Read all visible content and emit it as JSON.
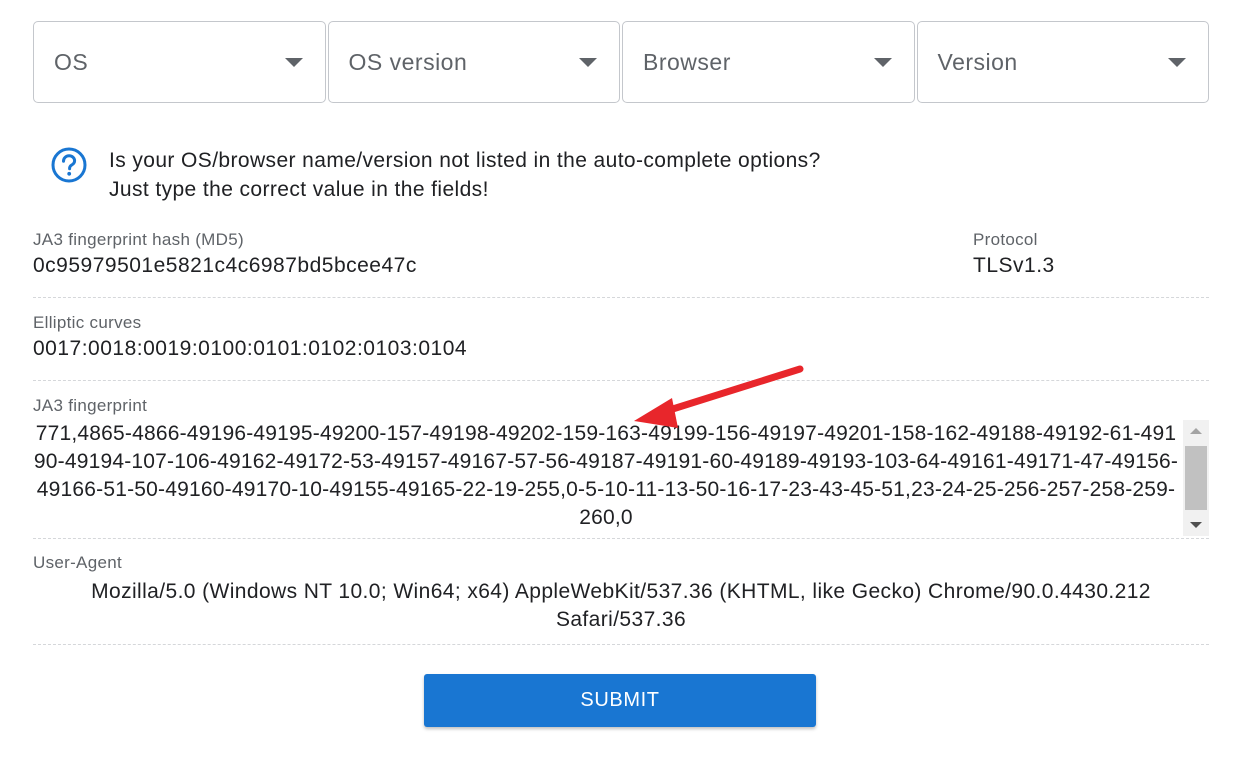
{
  "selects": [
    {
      "label": "OS"
    },
    {
      "label": "OS version"
    },
    {
      "label": "Browser"
    },
    {
      "label": "Version"
    }
  ],
  "hint": {
    "line1": "Is your OS/browser name/version not listed in the auto-complete options?",
    "line2": "Just type the correct value in the fields!",
    "icon": "help-circle-icon"
  },
  "ja3_hash": {
    "label": "JA3 fingerprint hash (MD5)",
    "value": "0c95979501e5821c4c6987bd5bcee47c"
  },
  "protocol": {
    "label": "Protocol",
    "value": "TLSv1.3"
  },
  "elliptic_curves": {
    "label": "Elliptic curves",
    "value": "0017:0018:0019:0100:0101:0102:0103:0104"
  },
  "ja3_fingerprint": {
    "label": "JA3 fingerprint",
    "value": "771,4865-4866-49196-49195-49200-157-49198-49202-159-163-49199-156-49197-49201-158-162-49188-49192-61-49190-49194-107-106-49162-49172-53-49157-49167-57-56-49187-49191-60-49189-49193-103-64-49161-49171-47-49156-49166-51-50-49160-49170-10-49155-49165-22-19-255,0-5-10-11-13-50-16-17-23-43-45-51,23-24-25-256-257-258-259-260,0"
  },
  "user_agent": {
    "label": "User-Agent",
    "value": "Mozilla/5.0 (Windows NT 10.0; Win64; x64) AppleWebKit/537.36 (KHTML, like Gecko) Chrome/90.0.4430.212 Safari/537.36"
  },
  "submit": {
    "label": "SUBMIT"
  },
  "colors": {
    "accent": "#1976d2",
    "annotation": "#e8262b"
  }
}
